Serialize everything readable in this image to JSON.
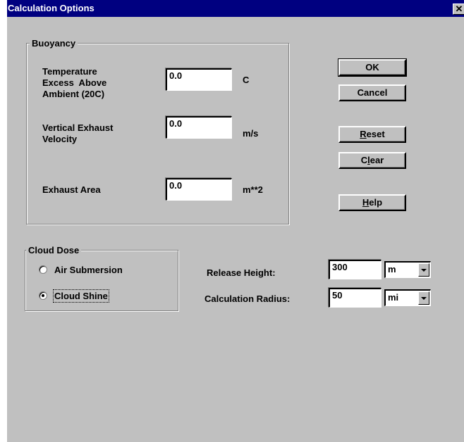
{
  "window": {
    "title": "Calculation Options",
    "close_glyph": "✕"
  },
  "buoyancy": {
    "legend": "Buoyancy",
    "temp_label": [
      "Temperature",
      "Excess  Above",
      "Ambient (20C)"
    ],
    "temp_value": "0.0",
    "temp_unit": "C",
    "velocity_label": [
      "Vertical Exhaust",
      "Velocity"
    ],
    "velocity_value": "0.0",
    "velocity_unit": "m/s",
    "area_label": "Exhaust Area",
    "area_value": "0.0",
    "area_unit": "m**2"
  },
  "buttons": {
    "ok": "OK",
    "cancel": "Cancel",
    "reset": "Reset",
    "clear": "Clear",
    "help": "Help"
  },
  "cloud_dose": {
    "legend": "Cloud Dose",
    "options": [
      {
        "label": "Air Submersion",
        "selected": false
      },
      {
        "label": "Cloud Shine",
        "selected": true
      }
    ]
  },
  "release_height": {
    "label": "Release Height:",
    "value": "300",
    "unit": "m"
  },
  "calc_radius": {
    "label": "Calculation Radius:",
    "value": "50",
    "unit": "mi"
  }
}
